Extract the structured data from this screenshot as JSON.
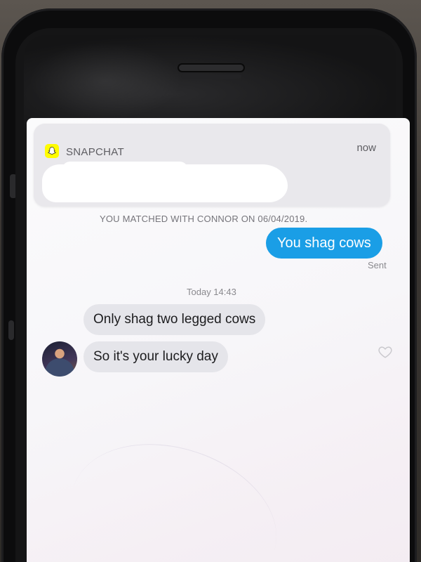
{
  "notification": {
    "app_name": "SNAPCHAT",
    "time": "now",
    "icon": "snapchat-ghost-icon"
  },
  "chat": {
    "match_text": "YOU MATCHED WITH CONNOR ON 06/04/2019.",
    "messages": [
      {
        "from": "me",
        "text": "You shag cows",
        "status": "Sent"
      },
      {
        "from": "them",
        "text": "Only shag two legged cows"
      },
      {
        "from": "them",
        "text": "So it's your lucky day"
      }
    ],
    "timestamp": "Today 14:43"
  },
  "colors": {
    "sent_bubble": "#1a9ee6",
    "received_bubble": "#e5e5ea",
    "snapchat_yellow": "#fffc00"
  }
}
